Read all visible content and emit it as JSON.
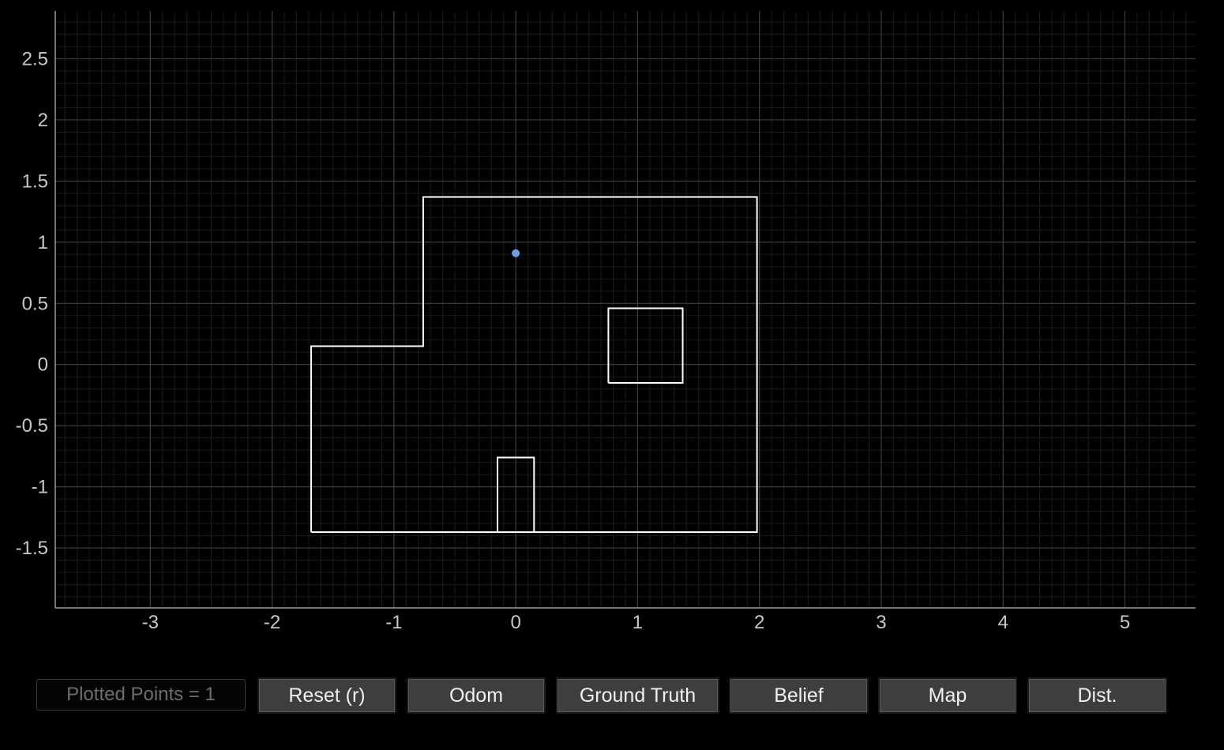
{
  "chart_data": {
    "type": "scatter",
    "xlim": [
      -3.78,
      5.58
    ],
    "ylim": [
      -1.99,
      2.89
    ],
    "x_ticks": [
      -3,
      -2,
      -1,
      0,
      1,
      2,
      3,
      4,
      5
    ],
    "y_ticks": [
      2.5,
      2,
      1.5,
      1,
      0.5,
      0,
      -0.5,
      -1,
      -1.5
    ],
    "x_tick_labels": [
      "-3",
      "-2",
      "-1",
      "0",
      "1",
      "2",
      "3",
      "4",
      "5"
    ],
    "y_tick_labels": [
      "2.5",
      "2",
      "1.5",
      "1",
      "0.5",
      "0",
      "-0.5",
      "-1",
      "-1.5"
    ],
    "grid": true,
    "minor_grid_step": 0.1,
    "series": [
      {
        "kind": "point",
        "color": "#6c9fe6",
        "points": [
          [
            0.0,
            0.91
          ]
        ]
      }
    ],
    "map_lines": [
      {
        "color": "#ffffff",
        "points": [
          [
            -1.68,
            -1.37
          ],
          [
            1.98,
            -1.37
          ],
          [
            1.98,
            1.37
          ],
          [
            -0.76,
            1.37
          ],
          [
            -0.76,
            0.15
          ],
          [
            -1.68,
            0.15
          ],
          [
            -1.68,
            -1.37
          ]
        ]
      },
      {
        "color": "#ffffff",
        "points": [
          [
            0.76,
            -0.15
          ],
          [
            1.37,
            -0.15
          ],
          [
            1.37,
            0.46
          ],
          [
            0.76,
            0.46
          ],
          [
            0.76,
            -0.15
          ]
        ]
      },
      {
        "color": "#ffffff",
        "points": [
          [
            -0.15,
            -1.37
          ],
          [
            -0.15,
            -0.76
          ],
          [
            0.15,
            -0.76
          ],
          [
            0.15,
            -1.37
          ]
        ]
      }
    ]
  },
  "toolbar": {
    "status": "Plotted Points = 1",
    "buttons": [
      {
        "id": "reset-button",
        "label": "Reset (r)"
      },
      {
        "id": "odom-button",
        "label": "Odom"
      },
      {
        "id": "ground-truth-button",
        "label": "Ground Truth"
      },
      {
        "id": "belief-button",
        "label": "Belief"
      },
      {
        "id": "map-button",
        "label": "Map"
      },
      {
        "id": "dist-button",
        "label": "Dist."
      }
    ]
  }
}
